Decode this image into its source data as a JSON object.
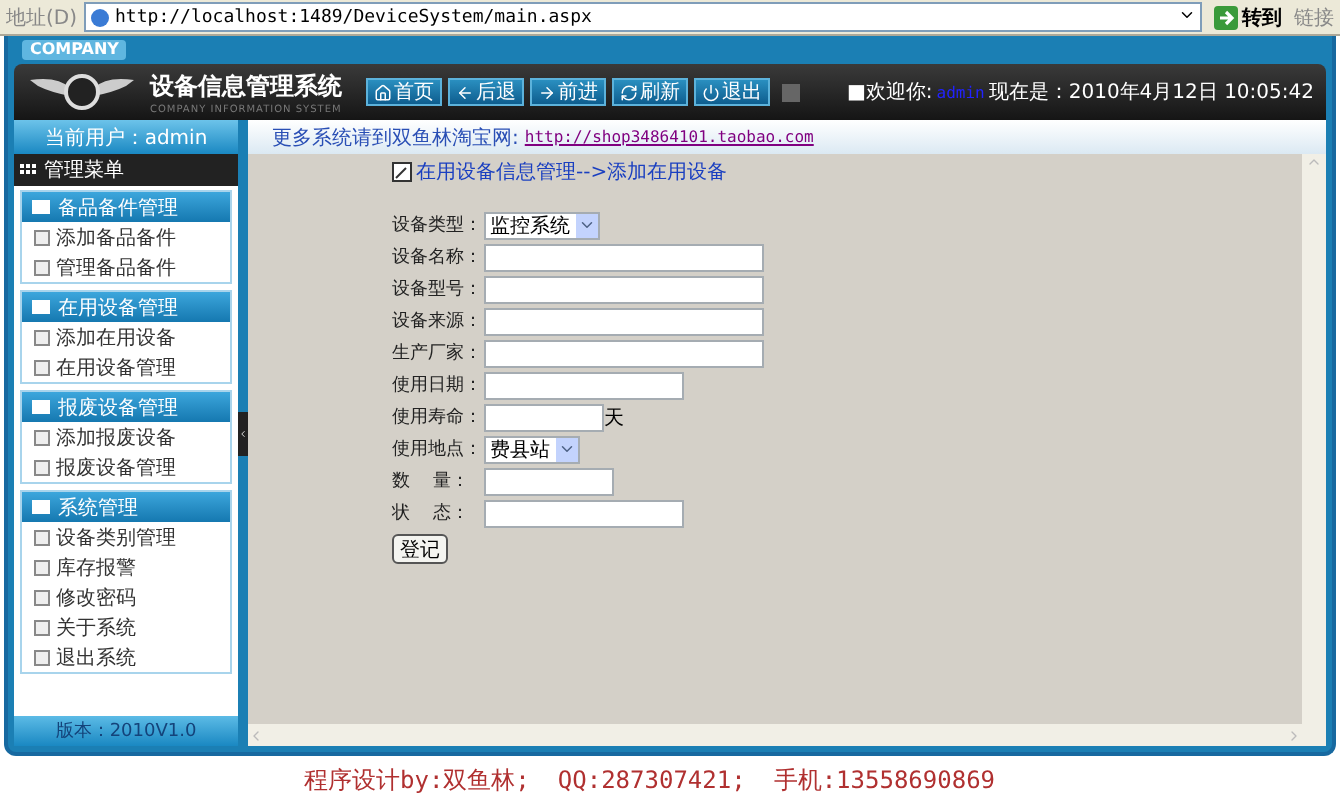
{
  "address_bar": {
    "label": "地址(D)",
    "url": "http://localhost:1489/DeviceSystem/main.aspx",
    "go": "转到",
    "links": "链接"
  },
  "header": {
    "company": "COMPANY",
    "title": "设备信息管理系统",
    "subtitle": "COMPANY INFORMATION SYSTEM",
    "nav": [
      "首页",
      "后退",
      "前进",
      "刷新",
      "退出"
    ],
    "welcome": "■欢迎你:",
    "user": "admin",
    "now_label": "现在是：",
    "datetime": "2010年4月12日 10:05:42"
  },
  "sidebar": {
    "current_user": "当前用户：admin",
    "menu_title": "管理菜单",
    "groups": [
      {
        "title": "备品备件管理",
        "items": [
          "添加备品备件",
          "管理备品备件"
        ]
      },
      {
        "title": "在用设备管理",
        "items": [
          "添加在用设备",
          "在用设备管理"
        ]
      },
      {
        "title": "报废设备管理",
        "items": [
          "添加报废设备",
          "报废设备管理"
        ]
      },
      {
        "title": "系统管理",
        "items": [
          "设备类别管理",
          "库存报警",
          "修改密码",
          "关于系统",
          "退出系统"
        ]
      }
    ],
    "version": "版本：2010V1.0"
  },
  "notice": {
    "text": "更多系统请到双鱼林淘宝网:",
    "link": "http://shop34864101.taobao.com"
  },
  "breadcrumb": "在用设备信息管理-->添加在用设备",
  "form": {
    "fields": [
      {
        "label": "设备类型：",
        "kind": "select",
        "value": "监控系统"
      },
      {
        "label": "设备名称：",
        "kind": "text"
      },
      {
        "label": "设备型号：",
        "kind": "text"
      },
      {
        "label": "设备来源：",
        "kind": "text"
      },
      {
        "label": "生产厂家：",
        "kind": "text"
      },
      {
        "label": "使用日期：",
        "kind": "text"
      },
      {
        "label": "使用寿命：",
        "kind": "text",
        "suffix": "天"
      },
      {
        "label": "使用地点：",
        "kind": "select",
        "value": "费县站"
      },
      {
        "label": "数    量：",
        "kind": "text"
      },
      {
        "label": "状    态：",
        "kind": "text"
      }
    ],
    "submit": "登记"
  },
  "footer": [
    "程序设计by:双鱼林;",
    "QQ:287307421;",
    "手机:13558690869"
  ]
}
